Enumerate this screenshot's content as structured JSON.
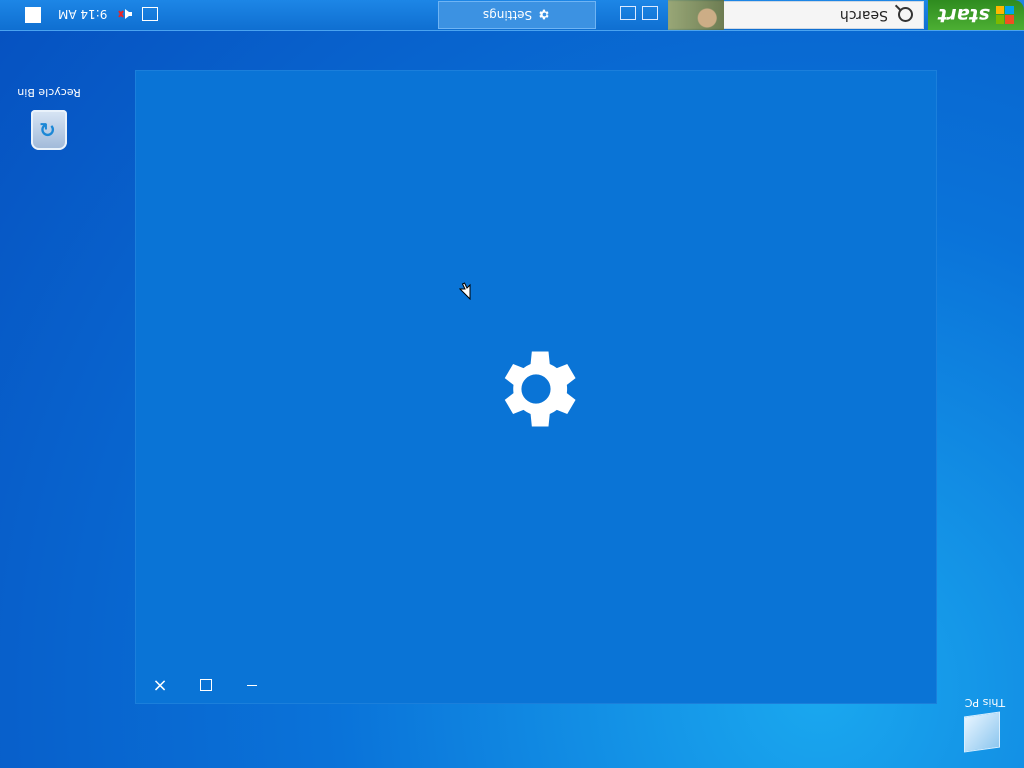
{
  "taskbar": {
    "start_label": "start",
    "search_placeholder": "Search",
    "active_window": "Settings",
    "time": "9:14 AM"
  },
  "desktop": {
    "recycle_bin": "Recycle Bin",
    "this_pc": "This PC"
  },
  "icons": {
    "start_flag": "windows-flag-icon",
    "search": "search-icon",
    "settings": "gear-icon",
    "tray_notice": "notification-icon",
    "tray_volume": "volume-muted-icon",
    "tray_network": "network-icon"
  },
  "colors": {
    "taskbar": "#0f6fd1",
    "window_bg": "#0a74d6",
    "start_green": "#3f9f2b"
  }
}
